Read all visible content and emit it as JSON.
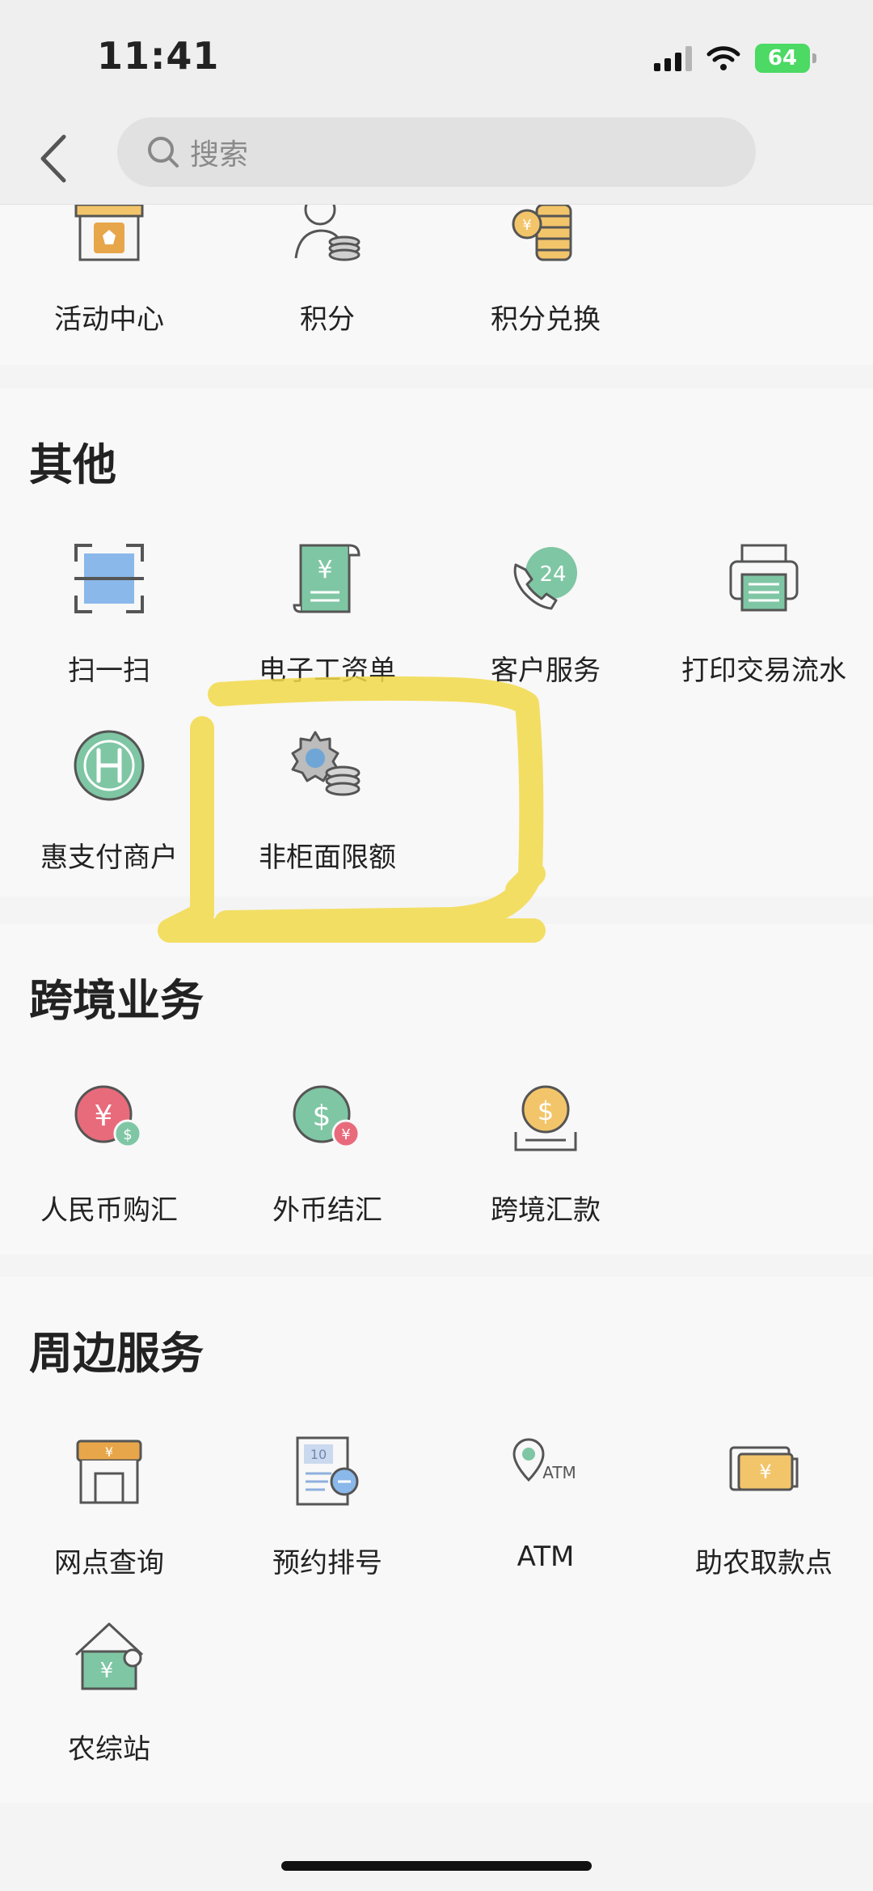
{
  "status_bar": {
    "time": "11:41",
    "battery": "64"
  },
  "search": {
    "placeholder": "搜索"
  },
  "sections": {
    "top": {
      "items": [
        "活动中心",
        "积分",
        "积分兑换"
      ]
    },
    "other": {
      "title": "其他",
      "items": [
        "扫一扫",
        "电子工资单",
        "客户服务",
        "打印交易流水",
        "惠支付商户",
        "非柜面限额"
      ]
    },
    "crossborder": {
      "title": "跨境业务",
      "items": [
        "人民币购汇",
        "外币结汇",
        "跨境汇款"
      ]
    },
    "nearby": {
      "title": "周边服务",
      "items": [
        "网点查询",
        "预约排号",
        "ATM",
        "助农取款点",
        "农综站"
      ]
    }
  },
  "icons": [
    "gift-box-icon",
    "points-user-icon",
    "coins-exchange-icon",
    "scan-icon",
    "salary-slip-icon",
    "customer-service-24-icon",
    "print-statement-icon",
    "merchant-icon",
    "transaction-limit-icon",
    "rmb-purchase-icon",
    "fx-settlement-icon",
    "cross-border-remittance-icon",
    "branch-icon",
    "appointment-icon",
    "atm-icon",
    "agri-cash-icon",
    "agri-station-icon"
  ],
  "colors": {
    "accent_green": "#3d9b74",
    "accent_orange": "#e8a64a",
    "highlight_yellow": "#f2d94a"
  }
}
